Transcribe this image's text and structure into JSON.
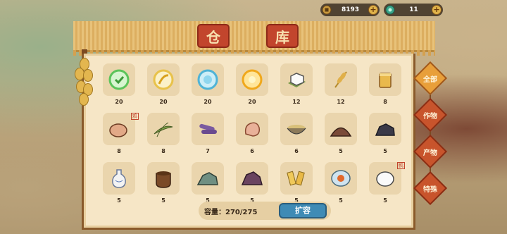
{
  "header": {
    "coins": {
      "icon": "coin-icon",
      "value": "8193"
    },
    "gems": {
      "icon": "gem-icon",
      "value": "11"
    }
  },
  "title": {
    "char1": "仓",
    "char2": "库"
  },
  "tabs": [
    {
      "label": "全部",
      "active": true
    },
    {
      "label": "作物",
      "active": false
    },
    {
      "label": "产物",
      "active": false
    },
    {
      "label": "特殊",
      "active": false
    }
  ],
  "items": [
    {
      "icon": "green-seal-icon",
      "count": "20"
    },
    {
      "icon": "feather-orb-icon",
      "count": "20"
    },
    {
      "icon": "blue-star-orb-icon",
      "count": "20"
    },
    {
      "icon": "gold-flower-orb-icon",
      "count": "20"
    },
    {
      "icon": "tofu-icon",
      "count": "12"
    },
    {
      "icon": "wheat-icon",
      "count": "12"
    },
    {
      "icon": "tofu-cup-icon",
      "count": "8"
    },
    {
      "icon": "chicken-egg-icon",
      "count": "8",
      "tag": "鸡"
    },
    {
      "icon": "leaves-icon",
      "count": "8"
    },
    {
      "icon": "purple-stalks-icon",
      "count": "7"
    },
    {
      "icon": "ginger-icon",
      "count": "6"
    },
    {
      "icon": "beans-bowl-icon",
      "count": "6"
    },
    {
      "icon": "soil-pile-icon",
      "count": "5"
    },
    {
      "icon": "coal-icon",
      "count": "5"
    },
    {
      "icon": "vase-icon",
      "count": "5"
    },
    {
      "icon": "wine-jar-icon",
      "count": "5"
    },
    {
      "icon": "green-stone-icon",
      "count": "5"
    },
    {
      "icon": "purple-stone-icon",
      "count": "5"
    },
    {
      "icon": "noodles-icon",
      "count": "5"
    },
    {
      "icon": "salted-egg-icon",
      "count": "5"
    },
    {
      "icon": "duck-egg-icon",
      "count": "5",
      "tag": "鸭"
    }
  ],
  "footer": {
    "capacity": "容量：270/275",
    "expand_label": "扩容"
  },
  "colors": {
    "accent": "#c2452d",
    "expand": "#3f8bb5"
  }
}
